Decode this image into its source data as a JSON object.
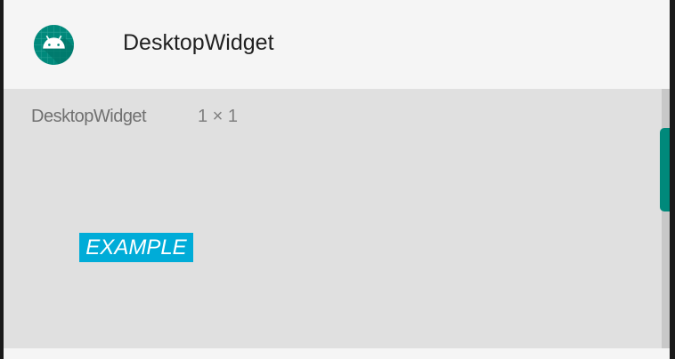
{
  "header": {
    "title": "DesktopWidget",
    "icon": "android-app-icon"
  },
  "widget": {
    "name": "DesktopWidget",
    "size": "1 × 1",
    "preview_label": "EXAMPLE"
  },
  "colors": {
    "accent": "#00897b",
    "preview_bg": "#00acd8",
    "content_bg": "#e0e0e0"
  }
}
